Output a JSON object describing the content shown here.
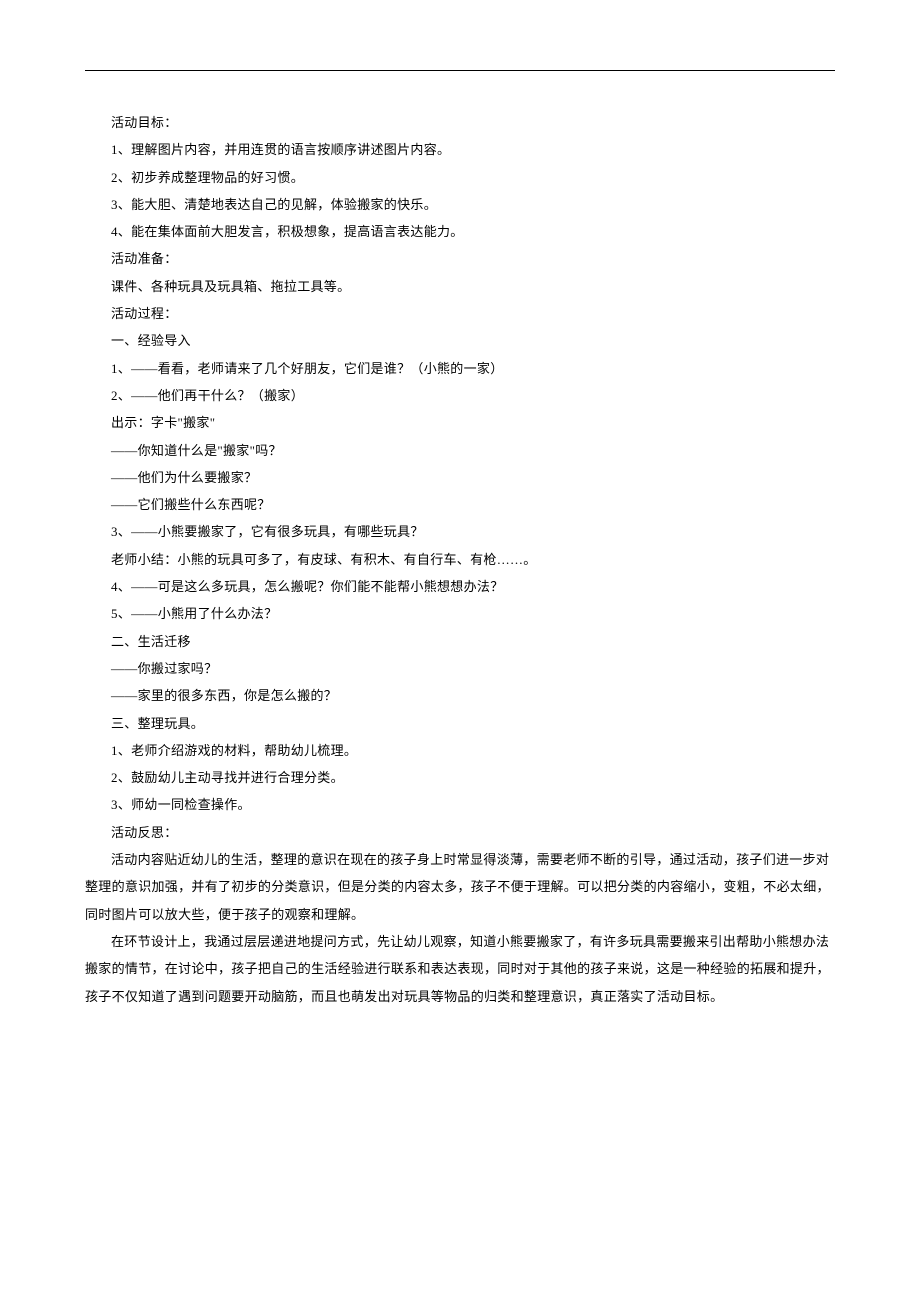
{
  "lines": [
    "活动目标：",
    "1、理解图片内容，并用连贯的语言按顺序讲述图片内容。",
    "2、初步养成整理物品的好习惯。",
    "3、能大胆、清楚地表达自己的见解，体验搬家的快乐。",
    "4、能在集体面前大胆发言，积极想象，提高语言表达能力。",
    "活动准备：",
    "课件、各种玩具及玩具箱、拖拉工具等。",
    "活动过程：",
    "一、经验导入",
    "1、——看看，老师请来了几个好朋友，它们是谁？（小熊的一家）",
    "2、——他们再干什么？（搬家）",
    "出示：字卡\"搬家\"",
    "——你知道什么是\"搬家\"吗？",
    "——他们为什么要搬家？",
    "——它们搬些什么东西呢？",
    "3、——小熊要搬家了，它有很多玩具，有哪些玩具？",
    "老师小结：小熊的玩具可多了，有皮球、有积木、有自行车、有枪……。",
    "4、——可是这么多玩具，怎么搬呢？你们能不能帮小熊想想办法？",
    "5、——小熊用了什么办法？",
    "二、生活迁移",
    "——你搬过家吗？",
    "——家里的很多东西，你是怎么搬的？",
    "三、整理玩具。",
    "1、老师介绍游戏的材料，帮助幼儿梳理。",
    "2、鼓励幼儿主动寻找并进行合理分类。",
    "3、师幼一同检查操作。",
    "活动反思："
  ],
  "paragraphs": [
    "活动内容贴近幼儿的生活，整理的意识在现在的孩子身上时常显得淡薄，需要老师不断的引导，通过活动，孩子们进一步对整理的意识加强，并有了初步的分类意识，但是分类的内容太多，孩子不便于理解。可以把分类的内容缩小，变粗，不必太细，同时图片可以放大些，便于孩子的观察和理解。",
    "在环节设计上，我通过层层递进地提问方式，先让幼儿观察，知道小熊要搬家了，有许多玩具需要搬来引出帮助小熊想办法搬家的情节，在讨论中，孩子把自己的生活经验进行联系和表达表现，同时对于其他的孩子来说，这是一种经验的拓展和提升，孩子不仅知道了遇到问题要开动脑筋，而且也萌发出对玩具等物品的归类和整理意识，真正落实了活动目标。"
  ]
}
